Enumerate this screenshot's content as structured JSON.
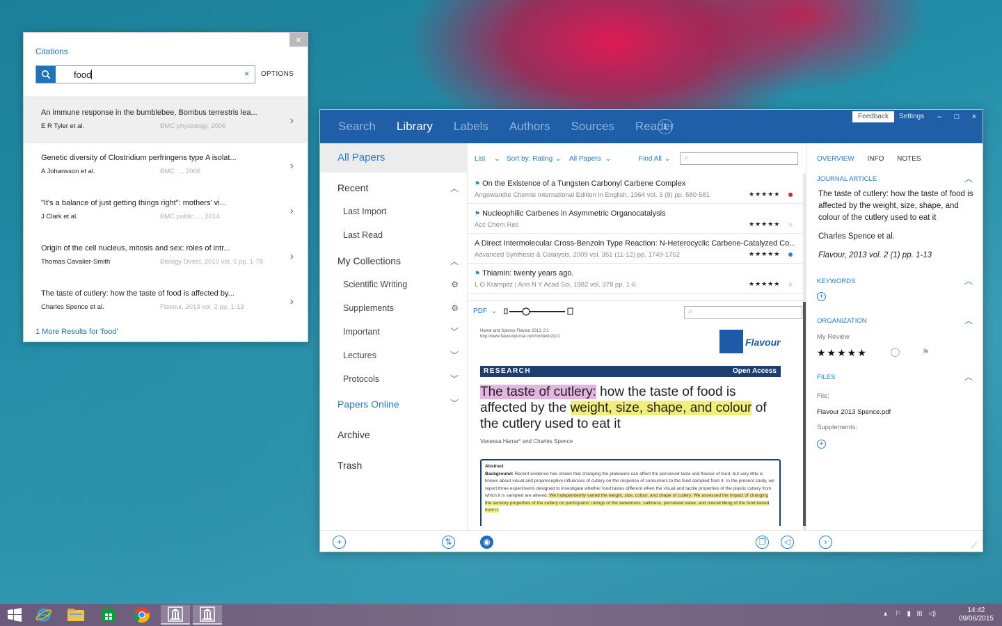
{
  "citations": {
    "title": "Citations",
    "search_value": "food",
    "clear": "×",
    "options": "OPTIONS",
    "close": "×",
    "results": [
      {
        "title": "An immune response in the bumblebee, Bombus terrestris lea...",
        "authors": "E R Tyler et al.",
        "source": "BMC physiology, 2006"
      },
      {
        "title": "Genetic diversity of Clostridium perfringens type A isolat...",
        "authors": "A Johansson et al.",
        "source": "BMC ..., 2006"
      },
      {
        "title": "\"It's a balance of just getting things right\": mothers' vi...",
        "authors": "J Clark et al.",
        "source": "BMC public ..., 2014"
      },
      {
        "title": "Origin of the cell nucleus, mitosis and sex: roles of intr...",
        "authors": "Thomas Cavalier-Smith",
        "source": "Biology Direct, 2010 vol. 5 pp. 1-78"
      },
      {
        "title": "The taste of cutlery: how the taste of food is affected by...",
        "authors": "Charles Spence et al.",
        "source": "Flavour, 2013 vol. 2 pp. 1-13"
      }
    ],
    "more": "1 More Results for 'food'"
  },
  "nav": {
    "tabs": [
      "Search",
      "Library",
      "Labels",
      "Authors",
      "Sources",
      "Reader"
    ],
    "active": "Library",
    "reader_badge": "1",
    "feedback": "Feedback",
    "settings": "Settings",
    "minimize": "–",
    "maximize": "□",
    "close": "×"
  },
  "sidebar": {
    "all_papers": "All Papers",
    "recent": "Recent",
    "last_import": "Last Import",
    "last_read": "Last Read",
    "my_collections": "My Collections",
    "collections": [
      "Scientific Writing",
      "Supplements",
      "Important",
      "Lectures",
      "Protocols"
    ],
    "papers_online": "Papers Online",
    "archive": "Archive",
    "trash": "Trash"
  },
  "list_toolbar": {
    "view": "List",
    "sort": "Sort by: Rating",
    "filter": "All Papers",
    "find": "Find All"
  },
  "papers": [
    {
      "title": "On the Existence of a Tungsten Carbonyl Carbene Complex",
      "journal": "Angewandte Chemie International Edition in English, 1964 vol. 3 (8) pp. 580-581",
      "stars": "★★★★★",
      "dot": "#e0262a",
      "flag": true
    },
    {
      "title": "Nucleophilic Carbenes in Asymmetric Organocatalysis",
      "journal": "Acc Chem Res",
      "stars": "★★★★★",
      "dot": "#e3e3e3",
      "flag": true
    },
    {
      "title": "A Direct Intermolecular Cross-Benzoin Type Reaction: N-Heterocyclic Carbene-Catalyzed Co...",
      "journal": "Advanced Synthesis & Catalysis, 2009 vol. 351 (11-12) pp. 1749-1752",
      "stars": "★★★★★",
      "dot": "#2b86d6",
      "flag": false
    },
    {
      "title": "Thiamin: twenty years ago.",
      "journal": "L O Krampitz | Ann N Y Acad Sci, 1982 vol. 378 pp. 1-6",
      "stars": "★★★★★",
      "dot": "#e3e3e3",
      "flag": true
    }
  ],
  "viewer_toolbar": {
    "format": "PDF"
  },
  "document": {
    "header": "Harrar and Spence Flavour 2013, 2:1\nhttp://www.flavourjournal.com/content/2/1/1",
    "logo_text": "Flavour",
    "band_left": "RESEARCH",
    "band_right": "Open Access",
    "title_part1": "The taste of cutlery:",
    "title_part2": " how the taste of food is affected by the ",
    "title_part3": "weight, size, shape, and colour",
    "title_part4": " of the cutlery used to eat it",
    "authors": "Vanessa Harrar* and Charles Spence",
    "abstract_heading": "Abstract",
    "abstract_bg": "Background:",
    "abstract_text": " Recent evidence has shown that changing the plateware can affect the perceived taste and flavour of food, but very little is known about visual and proprioceptive influences of cutlery on the response of consumers to the food sampled from it. In the present study, we report three experiments designed to investigate whether food tastes different when the visual and tactile properties of the plastic cutlery from which it is sampled are altered.",
    "abstract_hl": " We independently varied the weight, size, colour, and shape of cutlery. We assessed the impact of changing the sensory properties of the cutlery on participants' ratings of the sweetness, saltiness, perceived value, and overall liking of the food tasted from it."
  },
  "detail": {
    "tabs": [
      "OVERVIEW",
      "INFO",
      "NOTES"
    ],
    "type": "JOURNAL ARTICLE",
    "title": "The taste of cutlery: how the taste of food is affected by the weight, size, shape, and colour of the cutlery used to eat it",
    "authors": "Charles Spence et al.",
    "citation": "Flavour, 2013 vol. 2 (1) pp. 1-13",
    "keywords": "KEYWORDS",
    "organization": "ORGANIZATION",
    "my_review": "My Review",
    "rating": "★★★★★",
    "files": "FILES",
    "file_label": "File:",
    "file_name": "Flavour 2013 Spence.pdf",
    "supplements_label": "Supplements:"
  },
  "taskbar": {
    "time": "14:42",
    "date": "09/06/2015"
  }
}
